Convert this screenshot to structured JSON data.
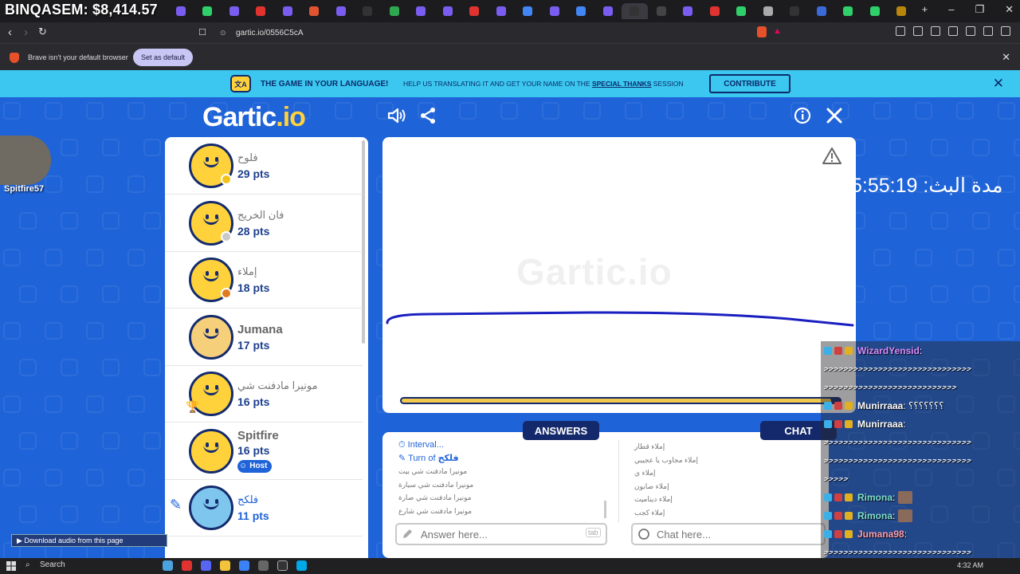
{
  "overlay_title": "BINQASEM: $8,414.57",
  "browser": {
    "url": "gartic.io/0556C5cA",
    "infobar_message": "Brave isn't your default browser",
    "set_default_label": "Set as default"
  },
  "banner": {
    "headline": "THE GAME IN YOUR LANGUAGE!",
    "text_before": "HELP US TRANSLATING IT AND GET YOUR NAME ON THE ",
    "link": "SPECIAL THANKS",
    "text_after": " SESSION",
    "contribute_label": "CONTRIBUTE"
  },
  "game": {
    "logo_main": "Gartic",
    "logo_suffix": ".io",
    "watermark": "Gartic.io"
  },
  "webcam_label": "Spitfire57",
  "players": [
    {
      "name": "فلوح",
      "pts": "29 pts",
      "badge_color": "#f2c21b"
    },
    {
      "name": "فان الخريج",
      "pts": "28 pts",
      "badge_color": "#c9c9c9"
    },
    {
      "name": "إملاء",
      "pts": "18 pts",
      "badge_color": "#e07a1f"
    },
    {
      "name": "Jumana",
      "pts": "17 pts"
    },
    {
      "name": "مونيرا مادفنت شي",
      "pts": "16 pts"
    },
    {
      "name": "Spitfire",
      "pts": "16 pts",
      "host_label": "Host"
    },
    {
      "name": "فلكح",
      "pts": "11 pts"
    }
  ],
  "timer_progress": 0.98,
  "answers_label": "ANSWERS",
  "chat_label": "CHAT",
  "answers": {
    "interval": "Interval...",
    "turn_prefix": "Turn of ",
    "turn_player": "فلكح",
    "lines": [
      "مونيرا مادفنت شي بيت",
      "مونيرا مادفنت شي سيارة",
      "مونيرا مادفنت شي صارة",
      "مونيرا مادفنت شي شارع"
    ],
    "input_placeholder": "Answer here...",
    "tab_hint": "tab"
  },
  "chat": {
    "lines": [
      "إملاء قطار",
      "إملاء مجاوب يا عجيبي",
      "إملاء ي",
      "إملاء صابون",
      "إملاء ديناميت",
      "إملاء كجب"
    ],
    "input_placeholder": "Chat here..."
  },
  "stream_timer": "مدة البث: 5:55:19",
  "stream_chat": [
    {
      "user": "WizardYensid",
      "suffix": " :",
      "color": "#d98cff"
    },
    {
      "text": "ﺣﺣﺣﺣﺣﺣﺣﺣﺣﺣﺣﺣﺣﺣﺣﺣﺣﺣﺣﺣﺣﺣﺣﺣﺣﺣﺣﺣﺣﺣ"
    },
    {
      "text": "ﺣﺣﺣﺣﺣﺣﺣﺣﺣﺣﺣﺣﺣﺣﺣﺣﺣﺣﺣﺣﺣﺣﺣﺣﺣﺣﺣ"
    },
    {
      "user": "Munirraaa",
      "suffix": " : ؟؟؟؟؟؟؟",
      "color": "#ffffff"
    },
    {
      "user": "Munirraaa",
      "suffix": " :",
      "color": "#ffffff"
    },
    {
      "text": "ﺣﺣﺣﺣﺣﺣﺣﺣﺣﺣﺣﺣﺣﺣﺣﺣﺣﺣﺣﺣﺣﺣﺣﺣﺣﺣﺣﺣﺣﺣ"
    },
    {
      "text": "ﺣﺣﺣﺣﺣﺣﺣﺣﺣﺣﺣﺣﺣﺣﺣﺣﺣﺣﺣﺣﺣﺣﺣﺣﺣﺣﺣﺣﺣﺣ"
    },
    {
      "text": "ﺣﺣﺣﺣﺣ"
    },
    {
      "user": "Rimona",
      "suffix": " :",
      "color": "#7fe0d0"
    },
    {
      "user": "Rimona",
      "suffix": " :",
      "color": "#7fe0d0"
    },
    {
      "user": "Jumana98",
      "suffix": " :",
      "color": "#ff9fb0"
    },
    {
      "text": "ﺣﺣﺣﺣﺣﺣﺣﺣﺣﺣﺣﺣﺣﺣﺣﺣﺣﺣﺣﺣﺣﺣﺣﺣﺣﺣﺣﺣﺣﺣ"
    }
  ],
  "download_label": "Download audio from this page",
  "taskbar": {
    "search_label": "Search",
    "clock": "4:32 AM"
  },
  "colors": {
    "game_bg": "#1f63d8",
    "navy": "#14296b",
    "banner": "#3bc7f0",
    "stroke": "#1a1fc0"
  }
}
